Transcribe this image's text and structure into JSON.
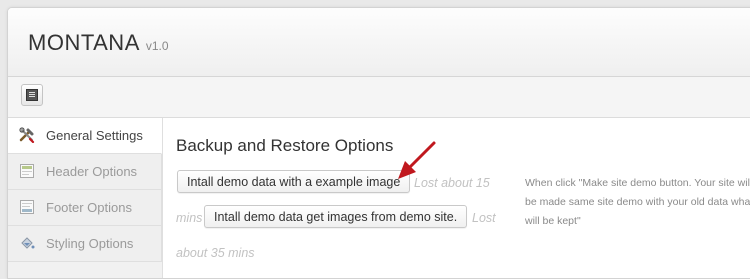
{
  "app": {
    "title": "MONTANA",
    "version": "v1.0"
  },
  "toolbar": {
    "icon": "layout-icon"
  },
  "sidebar": {
    "items": [
      {
        "label": "General Settings",
        "icon": "tools-icon",
        "active": true
      },
      {
        "label": "Header Options",
        "icon": "header-icon",
        "active": false
      },
      {
        "label": "Footer Options",
        "icon": "footer-icon",
        "active": false
      },
      {
        "label": "Styling Options",
        "icon": "paint-bucket-icon",
        "active": false
      }
    ]
  },
  "main": {
    "section_title": "Backup and Restore Options",
    "buttons": {
      "demo_example_image": "Intall demo data with a example image",
      "demo_site_images": "Intall demo data get images from demo site."
    },
    "hints": {
      "lost_15": "Lost about 15",
      "mins_prefix": "mins",
      "lost": "Lost",
      "about_35": "about 35 mins"
    },
    "description": "When click \"Make site demo button. Your site will be made same site demo with your old data what will be kept\""
  },
  "colors": {
    "arrow": "#c0181e",
    "active_text": "#444444",
    "inactive_text": "#9a9a9a"
  }
}
